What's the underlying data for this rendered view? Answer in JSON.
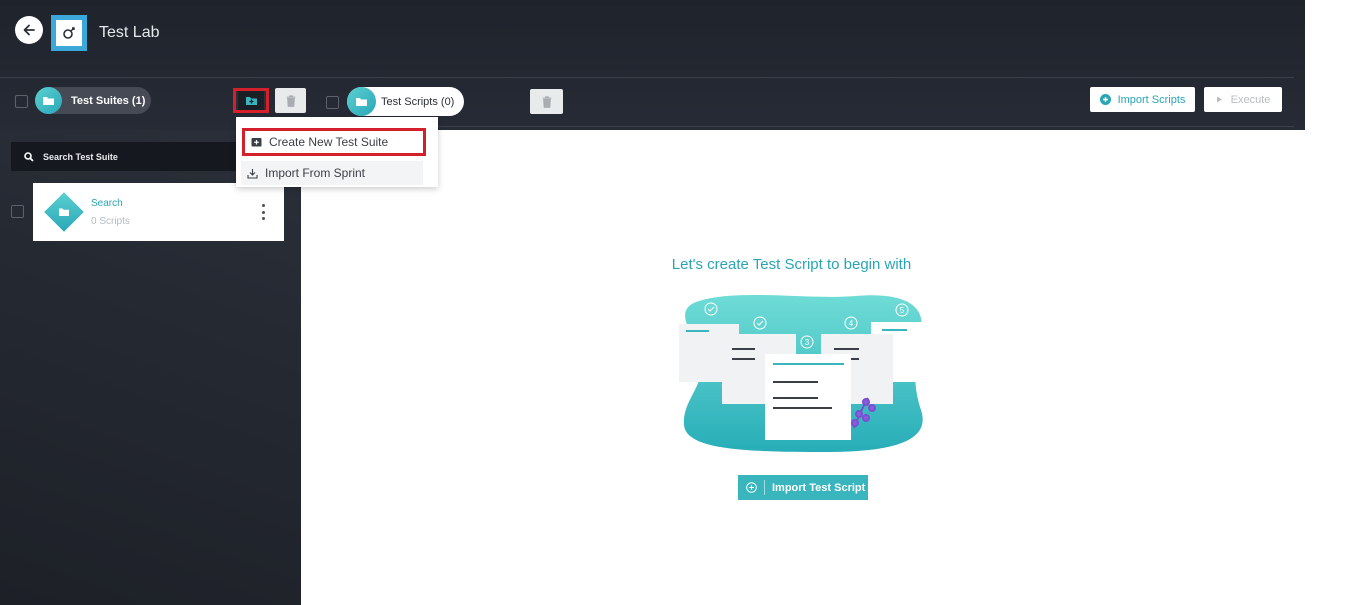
{
  "app": {
    "title": "Test Lab"
  },
  "suites_panel": {
    "pill_label": "Test Suites (1)",
    "search_placeholder": "Search Test Suite",
    "items": [
      {
        "name": "Search",
        "count": "0 Scripts"
      }
    ]
  },
  "dropdown": {
    "create_label": "Create New Test Suite",
    "import_label": "Import From Sprint"
  },
  "scripts_panel": {
    "pill_label": "Test Scripts (0)",
    "import_scripts_label": "Import Scripts",
    "execute_label": "Execute"
  },
  "empty_state": {
    "title": "Let's create Test Script to begin with",
    "button_label": "Import Test Script",
    "step_numbers": [
      "3",
      "4",
      "5"
    ]
  },
  "colors": {
    "accent": "#2aa5b4",
    "highlight": "#d4202a",
    "dark_bg": "#22262e"
  },
  "icons": {
    "back": "arrow-left-icon",
    "logo": "test-lab-logo-icon",
    "folder": "folder-icon",
    "add_folder": "folder-plus-icon",
    "trash": "trash-icon",
    "search": "search-icon",
    "kebab": "more-vertical-icon",
    "plus_circle": "plus-circle-icon",
    "play": "play-icon",
    "import": "import-icon"
  }
}
